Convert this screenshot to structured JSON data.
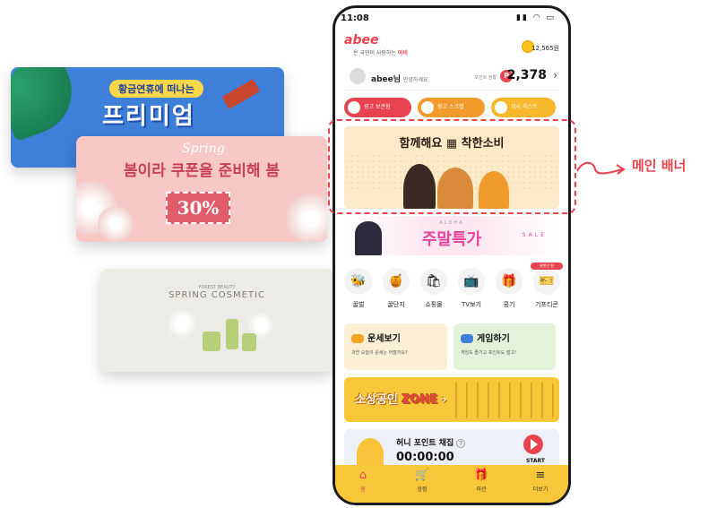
{
  "floating_banners": {
    "premium": {
      "tag": "황금연휴에 떠나는",
      "title": "프리미엄"
    },
    "coupon": {
      "script": "Spring",
      "title": "봄이라 쿠폰을 준비해 봄",
      "discount": "30%"
    },
    "cosmetic": {
      "kicker": "FOREST BEAUTY",
      "title": "SPRING COSMETIC"
    }
  },
  "callout": {
    "label": "메인 배너"
  },
  "status_bar": {
    "time": "11:08"
  },
  "header": {
    "logo": "abee",
    "tagline_prefix": "온 국민이 사랑하는",
    "tagline_brand": "아비",
    "points": "12,565원"
  },
  "user": {
    "name": "abee님",
    "greeting": "안녕하세요",
    "point_label": "포인트 현황",
    "point_badge": "P",
    "point_value": "2,378",
    "chevron": "›"
  },
  "quick_actions": [
    {
      "label": "광고 보관함"
    },
    {
      "label": "광고 스크랩"
    },
    {
      "label": "위시 리스트"
    }
  ],
  "main_banner": {
    "title": "함께해요 ▦ 착한소비"
  },
  "weekend_banner": {
    "kicker": "ALOHA",
    "title": "주말특가",
    "sale": "SALE"
  },
  "icon_grid": [
    {
      "label": "꿀벌",
      "icon": "🐝"
    },
    {
      "label": "꿀단지",
      "icon": "🍯"
    },
    {
      "label": "쇼핑몰",
      "icon": "🛍"
    },
    {
      "label": "TV보기",
      "icon": "📺"
    },
    {
      "label": "쿵기",
      "icon": "🎁"
    },
    {
      "label": "기프티콘",
      "icon": "🎫",
      "ribbon": "위챗인 편"
    }
  ],
  "cards": {
    "fortune": {
      "title": "운세보기",
      "subtitle": "과연 오늘의 운세는 어떨까요?"
    },
    "game": {
      "title": "게임하기",
      "subtitle": "게임도 즐기고 포인트도 벌고!"
    }
  },
  "zone_banner": {
    "prefix": "소상공인",
    "highlight": "ZONE",
    "arrow": "›"
  },
  "honey": {
    "title": "허니 포인트 채집",
    "help": "?",
    "timer": "00:00:00",
    "start": "START"
  },
  "tabs": [
    {
      "label": "홈",
      "icon": "⌂"
    },
    {
      "label": "상점",
      "icon": "🛒"
    },
    {
      "label": "미션",
      "icon": "🎁"
    },
    {
      "label": "더보기",
      "icon": "≡"
    }
  ],
  "colors": {
    "brand_red": "#e8434f",
    "brand_yellow": "#f7c739"
  }
}
